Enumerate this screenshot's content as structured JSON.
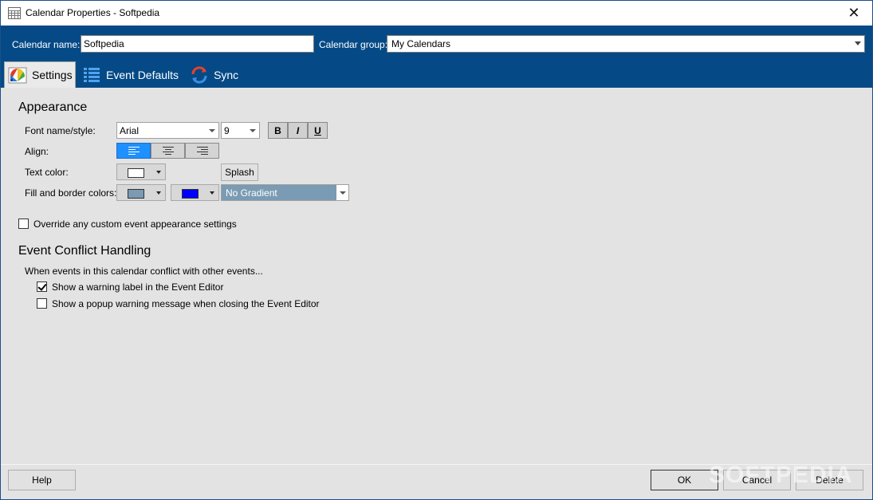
{
  "window": {
    "title": "Calendar Properties - Softpedia",
    "close_glyph": "✕"
  },
  "header": {
    "calendar_name_label": "Calendar name:",
    "calendar_name_value": "Softpedia",
    "calendar_group_label": "Calendar group:",
    "calendar_group_value": "My Calendars"
  },
  "tabs": [
    {
      "label": "Settings",
      "icon": "settings-palette-icon",
      "active": true
    },
    {
      "label": "Event Defaults",
      "icon": "list-icon",
      "active": false
    },
    {
      "label": "Sync",
      "icon": "sync-icon",
      "active": false
    }
  ],
  "appearance": {
    "title": "Appearance",
    "font_label": "Font name/style:",
    "font_name": "Arial",
    "font_size": "9",
    "bold": "B",
    "italic": "I",
    "underline": "U",
    "align_label": "Align:",
    "align_selected": "left",
    "text_color_label": "Text color:",
    "text_color": "#ffffff",
    "splash_label": "Splash",
    "fill_label": "Fill and border colors:",
    "fill_color": "#7a9bb3",
    "border_color": "#0000ff",
    "gradient_value": "No Gradient",
    "override_label": "Override any custom event appearance settings",
    "override_checked": false
  },
  "conflict": {
    "title": "Event Conflict Handling",
    "description": "When events in this calendar conflict with other events...",
    "warning_label": "Show a warning label in the Event Editor",
    "warning_checked": true,
    "popup_label": "Show a popup warning message when closing the Event Editor",
    "popup_checked": false
  },
  "footer": {
    "help": "Help",
    "ok": "OK",
    "cancel": "Cancel",
    "delete": "Delete"
  },
  "watermark": "SOFTPEDIA"
}
